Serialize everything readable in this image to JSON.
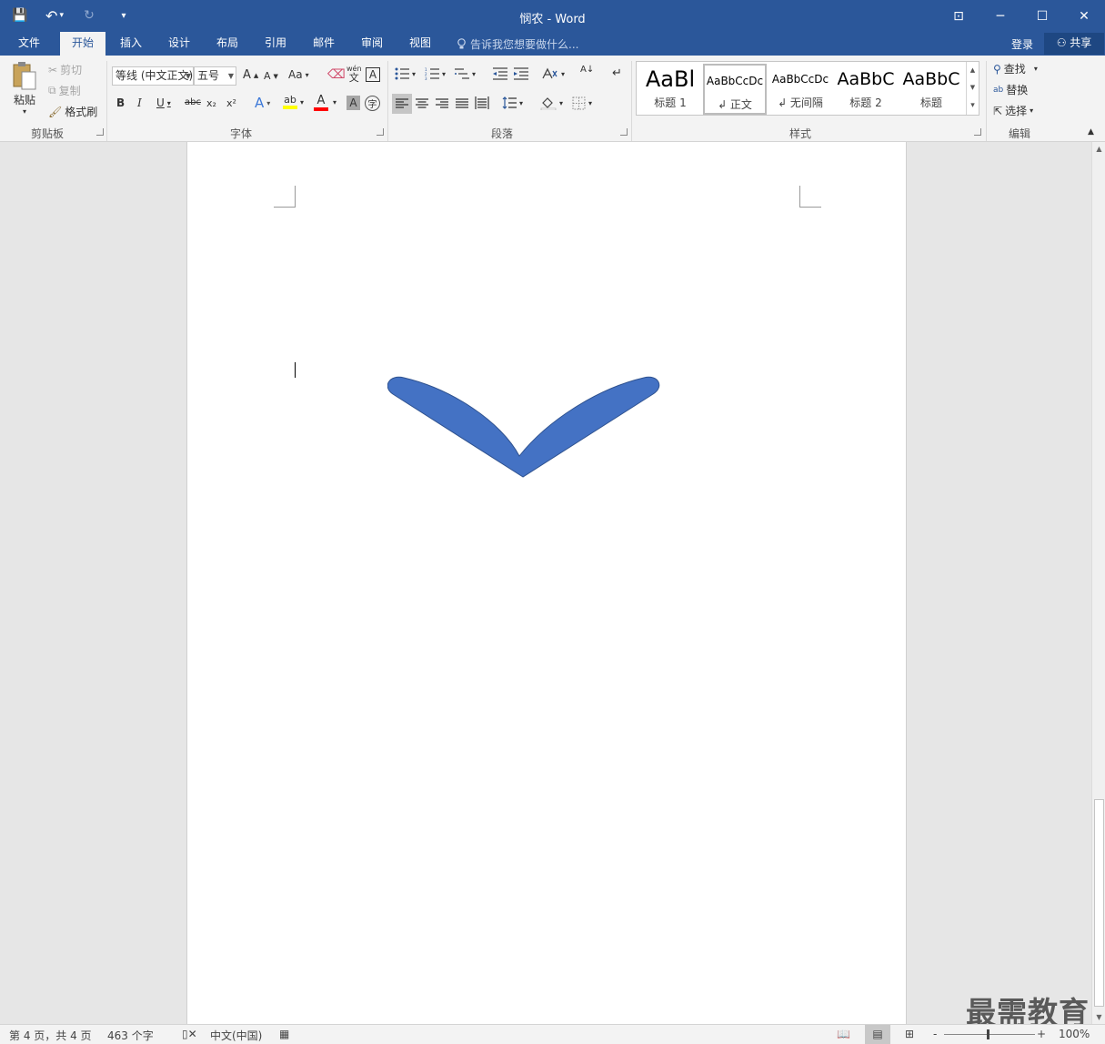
{
  "titlebar": {
    "title": "悯农 - Word",
    "qat": {
      "save_icon": "💾",
      "undo_icon": "↶",
      "undo_arrow": "▾",
      "redo_icon": "↻",
      "customize_icon": "▾"
    },
    "window": {
      "restore_ribbon": "⊡",
      "minimize": "─",
      "maximize": "☐",
      "close": "✕"
    }
  },
  "tabs": {
    "file": "文件",
    "home": "开始",
    "insert": "插入",
    "design": "设计",
    "layout": "布局",
    "references": "引用",
    "mailings": "邮件",
    "review": "审阅",
    "view": "视图",
    "tell_me": "告诉我您想要做什么...",
    "login": "登录",
    "share": "共享"
  },
  "clipboard": {
    "paste": "粘贴",
    "cut": "剪切",
    "copy": "复制",
    "format_painter": "格式刷",
    "label": "剪贴板"
  },
  "font": {
    "name": "等线 (中文正文)",
    "size": "五号",
    "grow": "A",
    "shrink": "A",
    "case": "Aa",
    "bold": "B",
    "italic": "I",
    "underline": "U",
    "strike": "abc",
    "sub": "x₂",
    "sup": "x²",
    "text_effects": "A",
    "highlight": "ab",
    "font_color": "A",
    "char_shading": "A",
    "enclose": "字",
    "phonetic": "wén",
    "phonetic_char": "文",
    "char_border": "A",
    "label": "字体"
  },
  "paragraph": {
    "label": "段落",
    "sort": "A↓",
    "show_marks": "↵"
  },
  "styles": {
    "label": "样式",
    "items": [
      {
        "sample": "AaBl",
        "name": "标题 1"
      },
      {
        "sample": "AaBbCcDc",
        "name": "↲ 正文"
      },
      {
        "sample": "AaBbCcDc",
        "name": "↲ 无间隔"
      },
      {
        "sample": "AaBbC",
        "name": "标题 2"
      },
      {
        "sample": "AaBbC",
        "name": "标题"
      }
    ],
    "scroll_up": "▲",
    "scroll_down": "▼",
    "more": "▾"
  },
  "editing": {
    "find": "查找",
    "replace": "替换",
    "select": "选择",
    "label": "编辑"
  },
  "shape": {
    "fill": "#4472c4",
    "stroke": "#2f528f"
  },
  "watermark": "最需教育",
  "status": {
    "page": "第 4 页，共 4 页",
    "words": "463 个字",
    "language": "中文(中国)",
    "zoom": "100%",
    "zoom_minus": "-",
    "zoom_plus": "+"
  }
}
